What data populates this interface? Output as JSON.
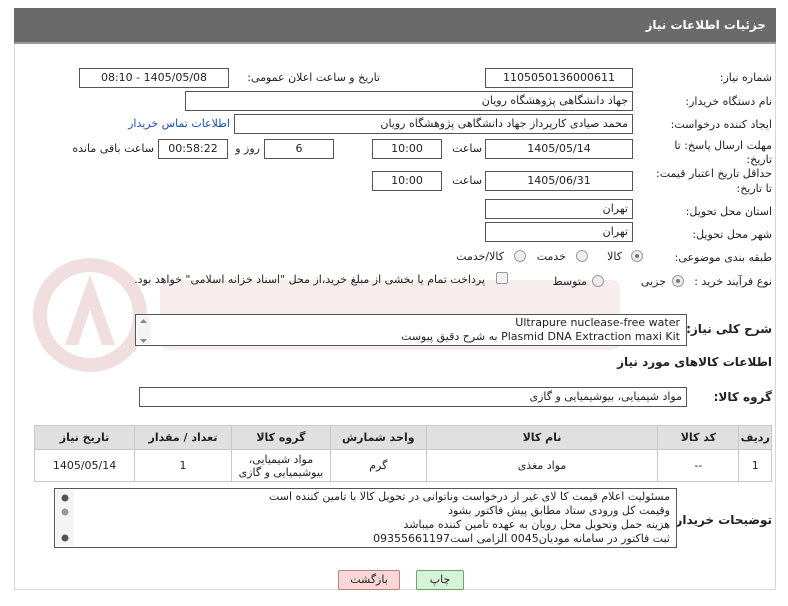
{
  "header": {
    "title": "جزئیات اطلاعات نیاز"
  },
  "fields": {
    "need_number_label": "شماره نیاز:",
    "need_number": "1105050136000611",
    "announce_label": "تاریخ و ساعت اعلان عمومی:",
    "announce_value": "1405/05/08 - 08:10",
    "buyer_label": "نام دستگاه خریدار:",
    "buyer_value": "جهاد دانشگاهی پژوهشگاه رویان",
    "creator_label": "ایجاد کننده درخواست:",
    "creator_value": "محمد صیادی کارپرداز جهاد دانشگاهی پژوهشگاه رویان",
    "contact_link": "اطلاعات تماس خریدار",
    "reply_label_1": "مهلت ارسال پاسخ: تا",
    "reply_label_2": "تاریخ:",
    "reply_date": "1405/05/14",
    "hour_label": "ساعت",
    "reply_time": "10:00",
    "days_value": "6",
    "days_label": "روز و",
    "remain_time": "00:58:22",
    "remain_label": "ساعت باقی مانده",
    "validity_label_1": "حداقل تاریخ اعتبار قیمت:",
    "validity_label_2": "تا تاریخ:",
    "validity_date": "1405/06/31",
    "validity_time": "10:00",
    "province_label": "استان محل تحویل:",
    "province_value": "تهران",
    "city_label": "شهر محل تحویل:",
    "city_value": "تهران",
    "category_label": "طبقه بندی موضوعی:",
    "cat_goods": "کالا",
    "cat_service": "خدمت",
    "cat_goods_service": "کالا/خدمت",
    "process_label": "نوع فرآیند خرید :",
    "proc_partial": "جزیی",
    "proc_medium": "متوسط",
    "payment_note": "پرداخت تمام یا بخشی از مبلغ خرید،از محل \"اسناد خزانه اسلامی\" خواهد بود.",
    "desc_label": "شرح کلی نیاز:",
    "desc_line1": "Ultrapure nuclease-free water",
    "desc_line2": "Plasmid DNA Extraction maxi Kit به شرح دقیق پیوست"
  },
  "goods": {
    "section_title": "اطلاعات کالاهای مورد نیاز",
    "group_label": "گروه کالا:",
    "group_value": "مواد شیمیایی، بیوشیمیایی و  گازی",
    "columns": [
      "ردیف",
      "کد کالا",
      "نام کالا",
      "واحد شمارش",
      "گروه کالا",
      "تعداد / مقدار",
      "تاریخ نیاز"
    ],
    "rows": [
      {
        "row": "1",
        "code": "--",
        "name": "مواد مغذی",
        "unit": "گرم",
        "group_1": "مواد شیمیایی،",
        "group_2": "بیوشیمیایی و گازی",
        "qty": "1",
        "date": "1405/05/14"
      }
    ]
  },
  "notes": {
    "label": "توضیحات خریدار:",
    "lines": [
      "مسئولیت اعلام قیمت کا لای  غیر از درخواست وناتوانی در تحویل کالا با تامین کننده است",
      "وقیمت کل ورودی ستاد مطابق پیش فاکتور بشود",
      "هزینه حمل وتحویل محل رویان به عهده تامین کننده میباشد",
      "ثبت فاکتور در سامانه مودیان0045 الزامی است09355661197"
    ]
  },
  "buttons": {
    "print": "چاپ",
    "back": "بازگشت"
  },
  "colors": {
    "header_bg": "#6a6a6a",
    "back_btn": "#f8d7d7",
    "print_btn": "#d7f2d7",
    "link": "#1a4fb5"
  }
}
